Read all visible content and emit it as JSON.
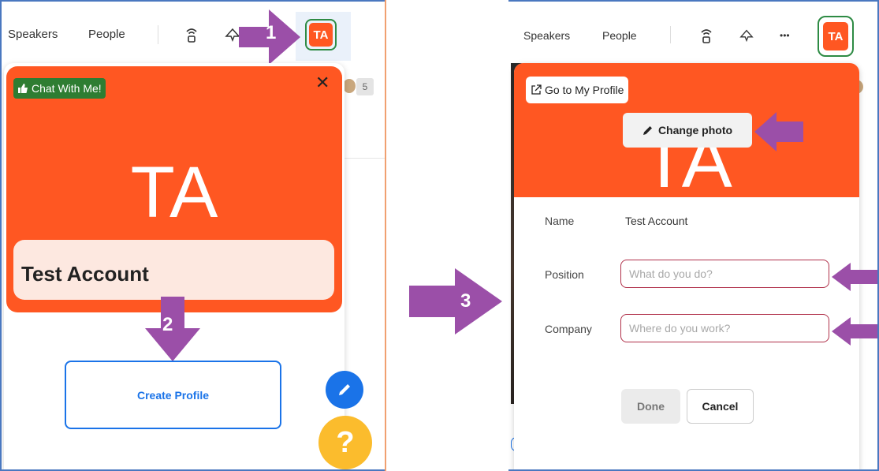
{
  "left": {
    "nav": {
      "speakers": "Speakers",
      "people": "People"
    },
    "avatar_initials": "TA",
    "callout_1": "1",
    "callout_2": "2",
    "count_badge": "5",
    "card": {
      "chat_badge": "Chat With Me!",
      "close": "✕",
      "initials": "TA",
      "name": "Test Account"
    },
    "create_profile": "Create Profile",
    "help": "?"
  },
  "center": {
    "callout_3": "3"
  },
  "right": {
    "nav": {
      "speakers": "Speakers",
      "people": "People",
      "more": "•••"
    },
    "avatar_initials": "TA",
    "go_to_profile": "Go to My Profile",
    "change_photo": "Change photo",
    "bg_initials": "TA",
    "fields": {
      "name_label": "Name",
      "name_value": "Test Account",
      "position_label": "Position",
      "position_placeholder": "What do you do?",
      "company_label": "Company",
      "company_placeholder": "Where do you work?"
    },
    "done": "Done",
    "cancel": "Cancel"
  },
  "colors": {
    "brand_orange": "#ff5722",
    "callout_purple": "#9b4fa8",
    "link_blue": "#1a73e8",
    "help_yellow": "#fbbc2d",
    "chat_green": "#2e7d32"
  }
}
